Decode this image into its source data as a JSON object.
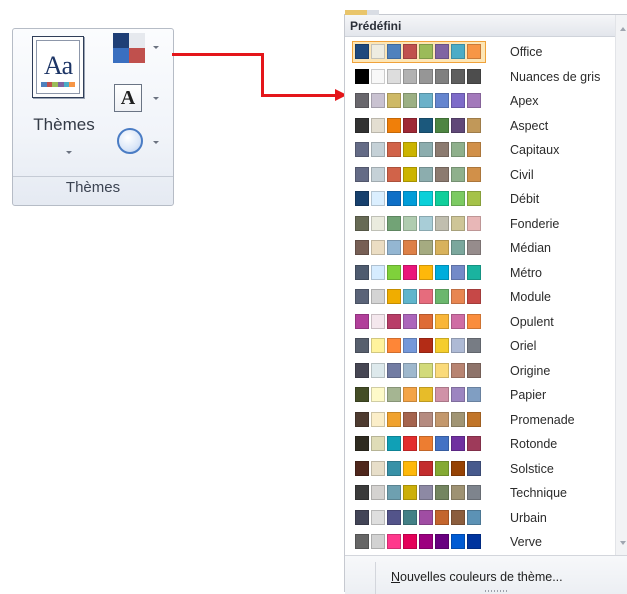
{
  "ribbon": {
    "themes_button_label": "Thèmes",
    "themes_icon_text": "Aa",
    "group_label": "Thèmes"
  },
  "gallery": {
    "header": "Prédéfini",
    "footer_prefix": "N",
    "footer_rest": "ouvelles couleurs de thème...",
    "themes": [
      {
        "name": "Office",
        "selected": true,
        "colors": [
          "#1f497d",
          "#eeece1",
          "#4f81bd",
          "#c0504d",
          "#9bbb59",
          "#8064a2",
          "#4bacc6",
          "#f79646"
        ]
      },
      {
        "name": "Nuances de gris",
        "colors": [
          "#000000",
          "#f8f8f8",
          "#dddddd",
          "#b2b2b2",
          "#969696",
          "#808080",
          "#5f5f5f",
          "#4d4d4d"
        ]
      },
      {
        "name": "Apex",
        "colors": [
          "#69676d",
          "#c9c2d1",
          "#ceb966",
          "#9cb084",
          "#6bb1c9",
          "#6585cf",
          "#7e6bc9",
          "#a379bb"
        ]
      },
      {
        "name": "Aspect",
        "colors": [
          "#323232",
          "#e3ded1",
          "#f07f09",
          "#9f2936",
          "#1b587c",
          "#4e8542",
          "#604878",
          "#c19859"
        ]
      },
      {
        "name": "Capitaux",
        "colors": [
          "#646b86",
          "#c5d1d7",
          "#d16349",
          "#ccb400",
          "#8cadae",
          "#8c7b70",
          "#8fb08c",
          "#d19049"
        ]
      },
      {
        "name": "Civil",
        "colors": [
          "#646b86",
          "#c5d1d7",
          "#d16349",
          "#ccb400",
          "#8cadae",
          "#8c7b70",
          "#8fb08c",
          "#d19049"
        ]
      },
      {
        "name": "Débit",
        "colors": [
          "#17406d",
          "#dbefff",
          "#0f6fc6",
          "#009dd9",
          "#0bd0d9",
          "#10cf9b",
          "#7cca62",
          "#a5c249"
        ]
      },
      {
        "name": "Fonderie",
        "colors": [
          "#676a55",
          "#eaebde",
          "#72a376",
          "#b0ccb0",
          "#a8cdd7",
          "#c0beaf",
          "#cec597",
          "#e8b7b7"
        ]
      },
      {
        "name": "Médian",
        "colors": [
          "#775f55",
          "#ebddc3",
          "#94b6d2",
          "#dd8047",
          "#a5ab81",
          "#d8b25c",
          "#7ba79d",
          "#968c8c"
        ]
      },
      {
        "name": "Métro",
        "colors": [
          "#4e5b6f",
          "#d6ecff",
          "#7fd13b",
          "#ea157a",
          "#feb80a",
          "#00addc",
          "#738ac8",
          "#1ab39f"
        ]
      },
      {
        "name": "Module",
        "colors": [
          "#5a6378",
          "#d4d4d4",
          "#f0ad00",
          "#60b5cc",
          "#e66c7d",
          "#6bb76d",
          "#e88651",
          "#c64847"
        ]
      },
      {
        "name": "Opulent",
        "colors": [
          "#b13f9a",
          "#f4e7ed",
          "#b83d68",
          "#ac66bb",
          "#de6c36",
          "#f9b639",
          "#cf6da4",
          "#fa8d3d"
        ]
      },
      {
        "name": "Oriel",
        "colors": [
          "#575f6d",
          "#fff39d",
          "#fe8637",
          "#7598d9",
          "#b32c16",
          "#f5cd2d",
          "#aebad5",
          "#777c84"
        ]
      },
      {
        "name": "Origine",
        "colors": [
          "#464653",
          "#dde9ec",
          "#727ca3",
          "#9fb8cd",
          "#d2da7a",
          "#fada7a",
          "#b88472",
          "#8e736a"
        ]
      },
      {
        "name": "Papier",
        "colors": [
          "#444d26",
          "#fefac9",
          "#a5b592",
          "#f3a447",
          "#e7bc29",
          "#d092a7",
          "#9c85c0",
          "#809ec2"
        ]
      },
      {
        "name": "Promenade",
        "colors": [
          "#4e3b30",
          "#fbeec9",
          "#f0a22e",
          "#a5644e",
          "#b58b80",
          "#c3986d",
          "#a19574",
          "#c17529"
        ]
      },
      {
        "name": "Rotonde",
        "colors": [
          "#2f2b20",
          "#dfdcb7",
          "#10a0b6",
          "#e32d2d",
          "#ed7d31",
          "#4472c4",
          "#7030a0",
          "#9e3a5a"
        ]
      },
      {
        "name": "Solstice",
        "colors": [
          "#4f271c",
          "#e7dec9",
          "#3891a7",
          "#feb80a",
          "#c32d2e",
          "#84aa33",
          "#964305",
          "#475a8d"
        ]
      },
      {
        "name": "Technique",
        "colors": [
          "#3b3b3b",
          "#d4d2d0",
          "#6ea0b0",
          "#ccaf0a",
          "#8d89a4",
          "#748560",
          "#9e9273",
          "#7e848d"
        ]
      },
      {
        "name": "Urbain",
        "colors": [
          "#424456",
          "#dedede",
          "#53548a",
          "#438086",
          "#a04da3",
          "#c4652d",
          "#8b5d3d",
          "#5c92b5"
        ]
      },
      {
        "name": "Verve",
        "colors": [
          "#666666",
          "#d2d2d2",
          "#ff388c",
          "#e40059",
          "#9c007f",
          "#68007f",
          "#005bd3",
          "#00349e"
        ]
      }
    ]
  },
  "colors": {
    "connector": "#e4161a",
    "selected_outline": "#f0a23a"
  }
}
